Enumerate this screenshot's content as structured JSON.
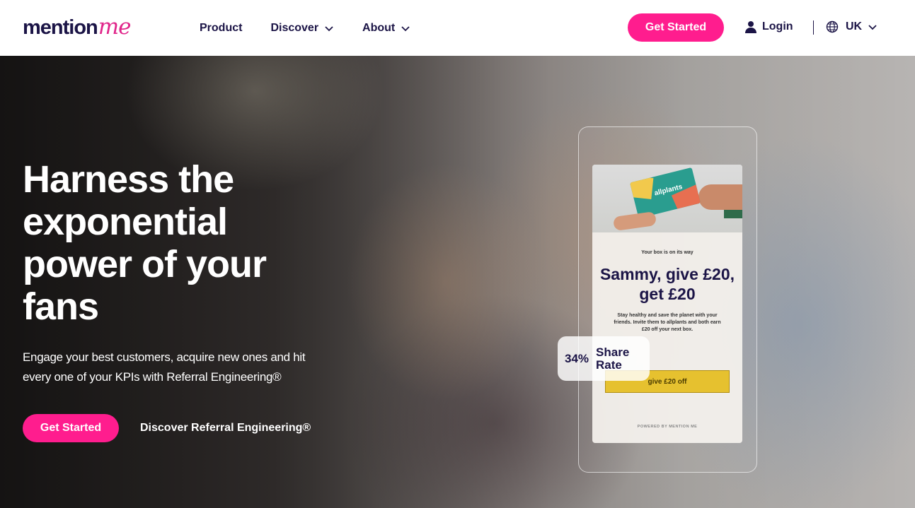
{
  "brand": {
    "logo_main": "mention",
    "logo_accent": "me",
    "accent_color": "#ff1d8e",
    "navy": "#1b1446"
  },
  "nav": {
    "items": [
      {
        "label": "Product",
        "has_dropdown": false
      },
      {
        "label": "Discover",
        "has_dropdown": true
      },
      {
        "label": "About",
        "has_dropdown": true
      }
    ],
    "cta_label": "Get Started",
    "login_label": "Login",
    "locale_label": "UK"
  },
  "hero": {
    "title": "Harness the exponential power of your fans",
    "subtitle": "Engage your best customers, acquire new ones and hit every one of your KPIs with Referral Engineering®",
    "primary_cta": "Get Started",
    "secondary_link": "Discover Referral Engineering®"
  },
  "phone_card": {
    "box_label": "allplants",
    "eyebrow": "Your box is on its way",
    "title": "Sammy, give £20, get £20",
    "body": "Stay healthy and save the planet with your friends. Invite them to allplants and both earn £20 off your next box.",
    "button_label": "give £20 off",
    "powered_by": "POWERED BY MENTION ME"
  },
  "stat": {
    "value": "34%",
    "label": "Share Rate"
  }
}
